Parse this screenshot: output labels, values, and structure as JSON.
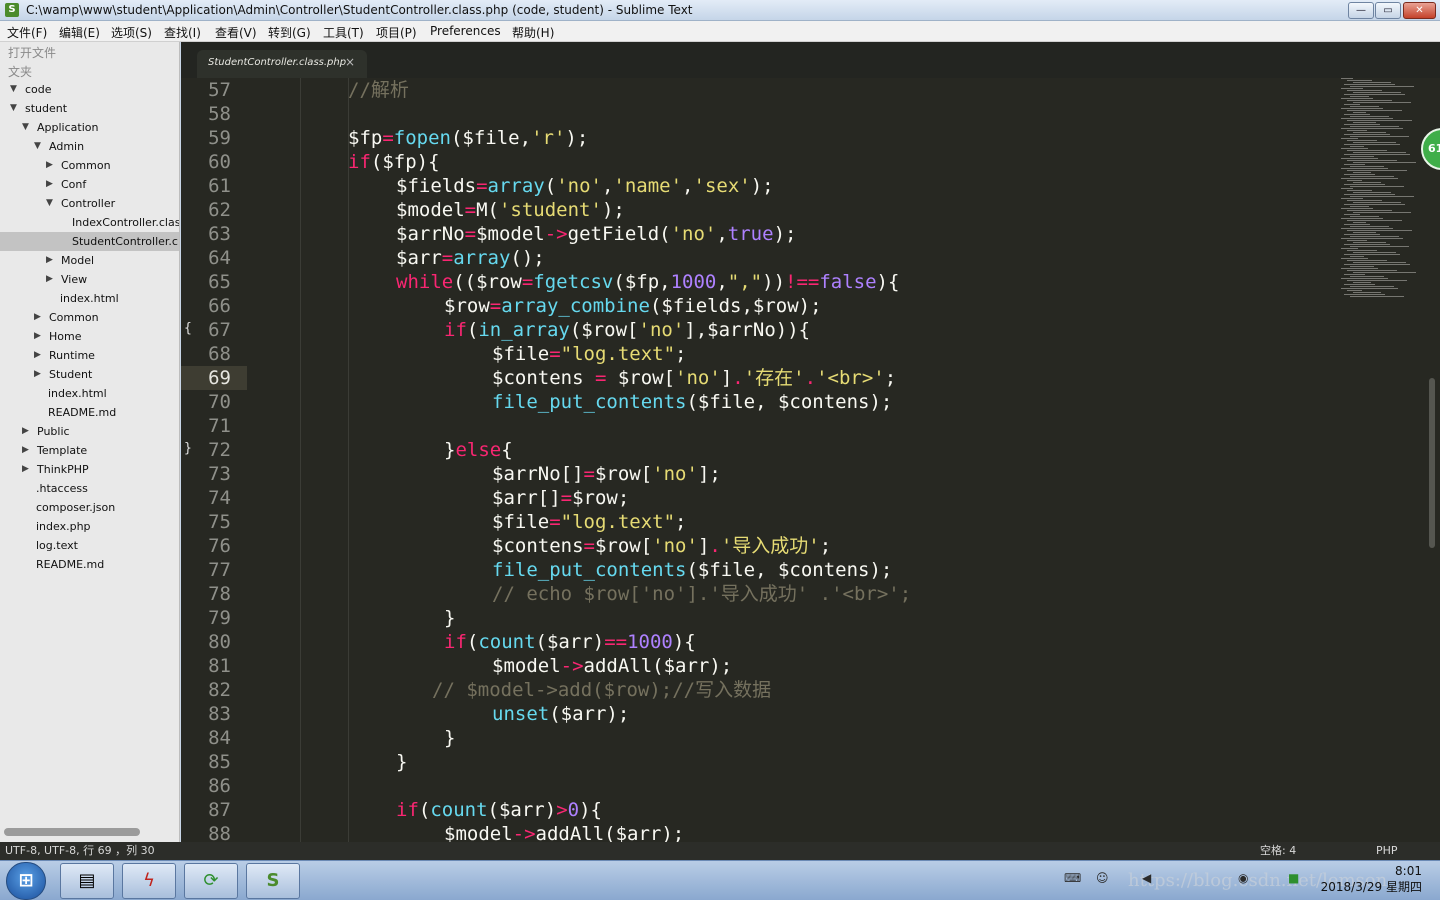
{
  "window": {
    "title": "C:\\wamp\\www\\student\\Application\\Admin\\Controller\\StudentController.class.php (code, student) - Sublime Text",
    "min": "—",
    "max": "▭",
    "close": "✕"
  },
  "menu": [
    "文件(F)",
    "编辑(E)",
    "选项(S)",
    "查找(I)",
    "查看(V)",
    "转到(G)",
    "工具(T)",
    "项目(P)",
    "Preferences",
    "帮助(H)"
  ],
  "sidebar": {
    "open_files": "打开文件",
    "folders": "文夹",
    "tree": [
      {
        "label": "code",
        "depth": 0,
        "arrow": "down"
      },
      {
        "label": "student",
        "depth": 0,
        "arrow": "down"
      },
      {
        "label": "Application",
        "depth": 1,
        "arrow": "down"
      },
      {
        "label": "Admin",
        "depth": 2,
        "arrow": "down"
      },
      {
        "label": "Common",
        "depth": 3,
        "arrow": "right"
      },
      {
        "label": "Conf",
        "depth": 3,
        "arrow": "right"
      },
      {
        "label": "Controller",
        "depth": 3,
        "arrow": "down"
      },
      {
        "label": "IndexController.class",
        "depth": 4,
        "arrow": "none"
      },
      {
        "label": "StudentController.cla",
        "depth": 4,
        "arrow": "none",
        "selected": true
      },
      {
        "label": "Model",
        "depth": 3,
        "arrow": "right"
      },
      {
        "label": "View",
        "depth": 3,
        "arrow": "right"
      },
      {
        "label": "index.html",
        "depth": 3,
        "arrow": "none"
      },
      {
        "label": "Common",
        "depth": 2,
        "arrow": "right"
      },
      {
        "label": "Home",
        "depth": 2,
        "arrow": "right"
      },
      {
        "label": "Runtime",
        "depth": 2,
        "arrow": "right"
      },
      {
        "label": "Student",
        "depth": 2,
        "arrow": "right"
      },
      {
        "label": "index.html",
        "depth": 2,
        "arrow": "none"
      },
      {
        "label": "README.md",
        "depth": 2,
        "arrow": "none"
      },
      {
        "label": "Public",
        "depth": 1,
        "arrow": "right"
      },
      {
        "label": "Template",
        "depth": 1,
        "arrow": "right"
      },
      {
        "label": "ThinkPHP",
        "depth": 1,
        "arrow": "right"
      },
      {
        "label": ".htaccess",
        "depth": 1,
        "arrow": "none"
      },
      {
        "label": "composer.json",
        "depth": 1,
        "arrow": "none"
      },
      {
        "label": "index.php",
        "depth": 1,
        "arrow": "none"
      },
      {
        "label": "log.text",
        "depth": 1,
        "arrow": "none"
      },
      {
        "label": "README.md",
        "depth": 1,
        "arrow": "none"
      }
    ]
  },
  "tab": {
    "name": "StudentController.class.php",
    "close": "×"
  },
  "editor": {
    "current_line": 69,
    "fold_markers": [
      {
        "line": 67,
        "glyph": "{"
      },
      {
        "line": 72,
        "glyph": "}"
      }
    ],
    "lines": [
      {
        "n": 57,
        "indent": 0,
        "t": [
          [
            "c",
            "//解析"
          ]
        ]
      },
      {
        "n": 58,
        "indent": 0,
        "t": []
      },
      {
        "n": 59,
        "indent": 0,
        "t": [
          [
            "p",
            "$fp"
          ],
          [
            "k",
            "="
          ],
          [
            "f",
            "fopen"
          ],
          [
            "p",
            "($file,"
          ],
          [
            "s",
            "'r'"
          ],
          [
            "p",
            ");"
          ]
        ]
      },
      {
        "n": 60,
        "indent": 0,
        "t": [
          [
            "k",
            "if"
          ],
          [
            "p",
            "($fp){"
          ]
        ]
      },
      {
        "n": 61,
        "indent": 1,
        "t": [
          [
            "p",
            "$fields"
          ],
          [
            "k",
            "="
          ],
          [
            "f",
            "array"
          ],
          [
            "p",
            "("
          ],
          [
            "s",
            "'no'"
          ],
          [
            "p",
            ","
          ],
          [
            "s",
            "'name'"
          ],
          [
            "p",
            ","
          ],
          [
            "s",
            "'sex'"
          ],
          [
            "p",
            ");"
          ]
        ]
      },
      {
        "n": 62,
        "indent": 1,
        "t": [
          [
            "p",
            "$model"
          ],
          [
            "k",
            "="
          ],
          [
            "p",
            "M("
          ],
          [
            "s",
            "'student'"
          ],
          [
            "p",
            ");"
          ]
        ]
      },
      {
        "n": 63,
        "indent": 1,
        "t": [
          [
            "p",
            "$arrNo"
          ],
          [
            "k",
            "="
          ],
          [
            "p",
            "$model"
          ],
          [
            "k",
            "->"
          ],
          [
            "p",
            "getField("
          ],
          [
            "s",
            "'no'"
          ],
          [
            "p",
            ","
          ],
          [
            "n",
            "true"
          ],
          [
            "p",
            ");"
          ]
        ]
      },
      {
        "n": 64,
        "indent": 1,
        "t": [
          [
            "p",
            "$arr"
          ],
          [
            "k",
            "="
          ],
          [
            "f",
            "array"
          ],
          [
            "p",
            "();"
          ]
        ]
      },
      {
        "n": 65,
        "indent": 1,
        "t": [
          [
            "k",
            "while"
          ],
          [
            "p",
            "(($row"
          ],
          [
            "k",
            "="
          ],
          [
            "f",
            "fgetcsv"
          ],
          [
            "p",
            "($fp,"
          ],
          [
            "n",
            "1000"
          ],
          [
            "p",
            ","
          ],
          [
            "s",
            "\",\""
          ],
          [
            "p",
            "))"
          ],
          [
            "k",
            "!=="
          ],
          [
            "n",
            "false"
          ],
          [
            "p",
            "){"
          ]
        ]
      },
      {
        "n": 66,
        "indent": 2,
        "t": [
          [
            "p",
            "$row"
          ],
          [
            "k",
            "="
          ],
          [
            "f",
            "array_combine"
          ],
          [
            "p",
            "($fields,$row);"
          ]
        ]
      },
      {
        "n": 67,
        "indent": 2,
        "t": [
          [
            "k",
            "if"
          ],
          [
            "p",
            "("
          ],
          [
            "f",
            "in_array"
          ],
          [
            "p",
            "($row["
          ],
          [
            "s",
            "'no'"
          ],
          [
            "p",
            "],$arrNo)){"
          ]
        ]
      },
      {
        "n": 68,
        "indent": 3,
        "t": [
          [
            "p",
            "$file"
          ],
          [
            "k",
            "="
          ],
          [
            "s",
            "\"log.text\""
          ],
          [
            "p",
            ";"
          ]
        ]
      },
      {
        "n": 69,
        "indent": 3,
        "t": [
          [
            "p",
            "$contens "
          ],
          [
            "k",
            "="
          ],
          [
            "p",
            " $row["
          ],
          [
            "s",
            "'no'"
          ],
          [
            "p",
            "]"
          ],
          [
            "k",
            "."
          ],
          [
            "s",
            "'存在'"
          ],
          [
            "k",
            "."
          ],
          [
            "s",
            "'<br>'"
          ],
          [
            "p",
            ";"
          ]
        ]
      },
      {
        "n": 70,
        "indent": 3,
        "t": [
          [
            "f",
            "file_put_contents"
          ],
          [
            "p",
            "($file, $contens);"
          ]
        ]
      },
      {
        "n": 71,
        "indent": 0,
        "t": []
      },
      {
        "n": 72,
        "indent": 2,
        "t": [
          [
            "p",
            "}"
          ],
          [
            "k",
            "else"
          ],
          [
            "p",
            "{"
          ]
        ]
      },
      {
        "n": 73,
        "indent": 3,
        "t": [
          [
            "p",
            "$arrNo[]"
          ],
          [
            "k",
            "="
          ],
          [
            "p",
            "$row["
          ],
          [
            "s",
            "'no'"
          ],
          [
            "p",
            "];"
          ]
        ]
      },
      {
        "n": 74,
        "indent": 3,
        "t": [
          [
            "p",
            "$arr[]"
          ],
          [
            "k",
            "="
          ],
          [
            "p",
            "$row;"
          ]
        ]
      },
      {
        "n": 75,
        "indent": 3,
        "t": [
          [
            "p",
            "$file"
          ],
          [
            "k",
            "="
          ],
          [
            "s",
            "\"log.text\""
          ],
          [
            "p",
            ";"
          ]
        ]
      },
      {
        "n": 76,
        "indent": 3,
        "t": [
          [
            "p",
            "$contens"
          ],
          [
            "k",
            "="
          ],
          [
            "p",
            "$row["
          ],
          [
            "s",
            "'no'"
          ],
          [
            "p",
            "]"
          ],
          [
            "k",
            "."
          ],
          [
            "s",
            "'导入成功'"
          ],
          [
            "p",
            ";"
          ]
        ]
      },
      {
        "n": 77,
        "indent": 3,
        "t": [
          [
            "f",
            "file_put_contents"
          ],
          [
            "p",
            "($file, $contens);"
          ]
        ]
      },
      {
        "n": 78,
        "indent": 3,
        "t": [
          [
            "c",
            "// echo $row['no'].'导入成功' .'<br>';"
          ]
        ]
      },
      {
        "n": 79,
        "indent": 2,
        "t": [
          [
            "p",
            "}"
          ]
        ]
      },
      {
        "n": 80,
        "indent": 2,
        "t": [
          [
            "k",
            "if"
          ],
          [
            "p",
            "("
          ],
          [
            "f",
            "count"
          ],
          [
            "p",
            "($arr)"
          ],
          [
            "k",
            "=="
          ],
          [
            "n",
            "1000"
          ],
          [
            "p",
            "){"
          ]
        ]
      },
      {
        "n": 81,
        "indent": 3,
        "t": [
          [
            "p",
            "$model"
          ],
          [
            "k",
            "->"
          ],
          [
            "p",
            "addAll($arr);"
          ]
        ]
      },
      {
        "n": 82,
        "indent": 1.75,
        "t": [
          [
            "c",
            "// $model->add($row);//写入数据"
          ]
        ]
      },
      {
        "n": 83,
        "indent": 3,
        "t": [
          [
            "f",
            "unset"
          ],
          [
            "p",
            "($arr);"
          ]
        ]
      },
      {
        "n": 84,
        "indent": 2,
        "t": [
          [
            "p",
            "}"
          ]
        ]
      },
      {
        "n": 85,
        "indent": 1,
        "t": [
          [
            "p",
            "}"
          ]
        ]
      },
      {
        "n": 86,
        "indent": 0,
        "t": []
      },
      {
        "n": 87,
        "indent": 1,
        "t": [
          [
            "k",
            "if"
          ],
          [
            "p",
            "("
          ],
          [
            "f",
            "count"
          ],
          [
            "p",
            "($arr)"
          ],
          [
            "k",
            ">"
          ],
          [
            "n",
            "0"
          ],
          [
            "p",
            "){"
          ]
        ]
      },
      {
        "n": 88,
        "indent": 2,
        "t": [
          [
            "p",
            "$model"
          ],
          [
            "k",
            "->"
          ],
          [
            "p",
            "addAll($arr);"
          ]
        ]
      }
    ]
  },
  "badge": "61",
  "status": {
    "left": "UTF-8, UTF-8, 行 69 ，列 30",
    "spaces": "空格: 4",
    "syntax": "PHP"
  },
  "taskbar": {
    "start": "⊞",
    "apps": [
      {
        "name": "explorer",
        "glyph": "▤"
      },
      {
        "name": "filezilla",
        "glyph": "ϟ"
      },
      {
        "name": "refresh",
        "glyph": "⟳"
      },
      {
        "name": "sublime",
        "glyph": "S"
      }
    ],
    "time": "8:01",
    "date": "2018/3/29 星期四",
    "watermark": "https://blog.csdn.net/lemson"
  },
  "colors": {
    "keyword": "#f92672",
    "func": "#66d9ef",
    "string": "#e6db74",
    "number": "#ae81ff",
    "comment": "#75715e",
    "plain": "#f8f8f2"
  }
}
